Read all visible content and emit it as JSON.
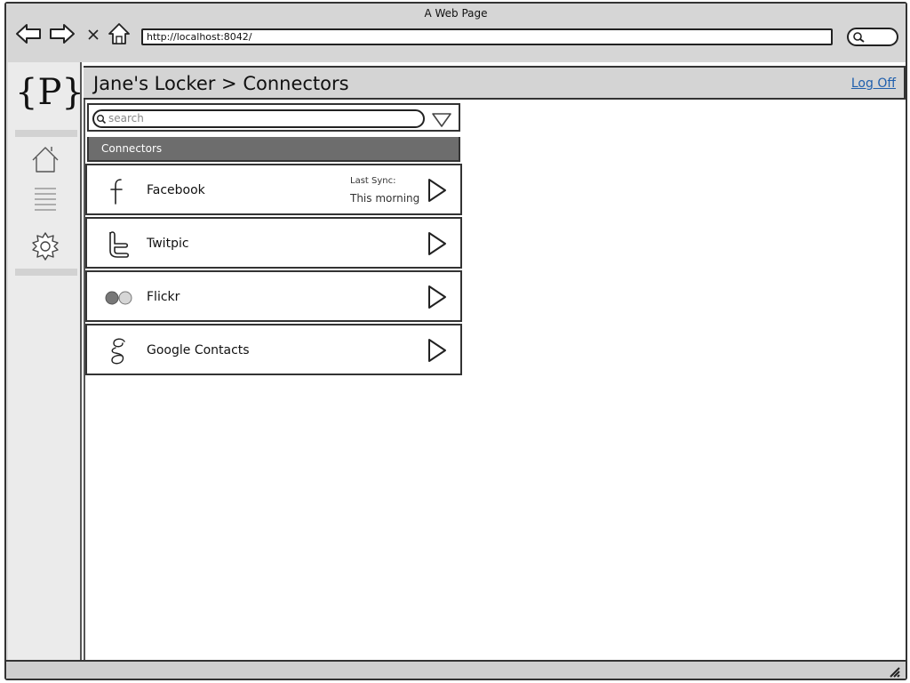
{
  "window": {
    "title": "A Web Page",
    "url": "http://localhost:8042/"
  },
  "nav": {
    "icons": [
      "back-arrow-icon",
      "forward-arrow-icon",
      "close-x-icon",
      "home-icon",
      "search-icon"
    ]
  },
  "logo": {
    "text": "{P}"
  },
  "sidebar": {
    "icons": [
      "home-icon",
      "list-icon",
      "gear-icon"
    ]
  },
  "header": {
    "breadcrumb": "Jane's Locker > Connectors",
    "logoff": "Log Off"
  },
  "search": {
    "placeholder": "search"
  },
  "section": {
    "title": "Connectors"
  },
  "connectors": [
    {
      "name": "Facebook",
      "icon": "facebook-icon",
      "sync_label": "Last Sync:",
      "sync_value": "This morning"
    },
    {
      "name": "Twitpic",
      "icon": "twitter-icon",
      "sync_label": "",
      "sync_value": ""
    },
    {
      "name": "Flickr",
      "icon": "flickr-icon",
      "sync_label": "",
      "sync_value": ""
    },
    {
      "name": "Google Contacts",
      "icon": "google-icon",
      "sync_label": "",
      "sync_value": ""
    }
  ],
  "colors": {
    "chrome": "#d6d6d6",
    "section_header": "#6d6d6d",
    "link": "#1f5fad",
    "rail": "#ebebeb"
  }
}
